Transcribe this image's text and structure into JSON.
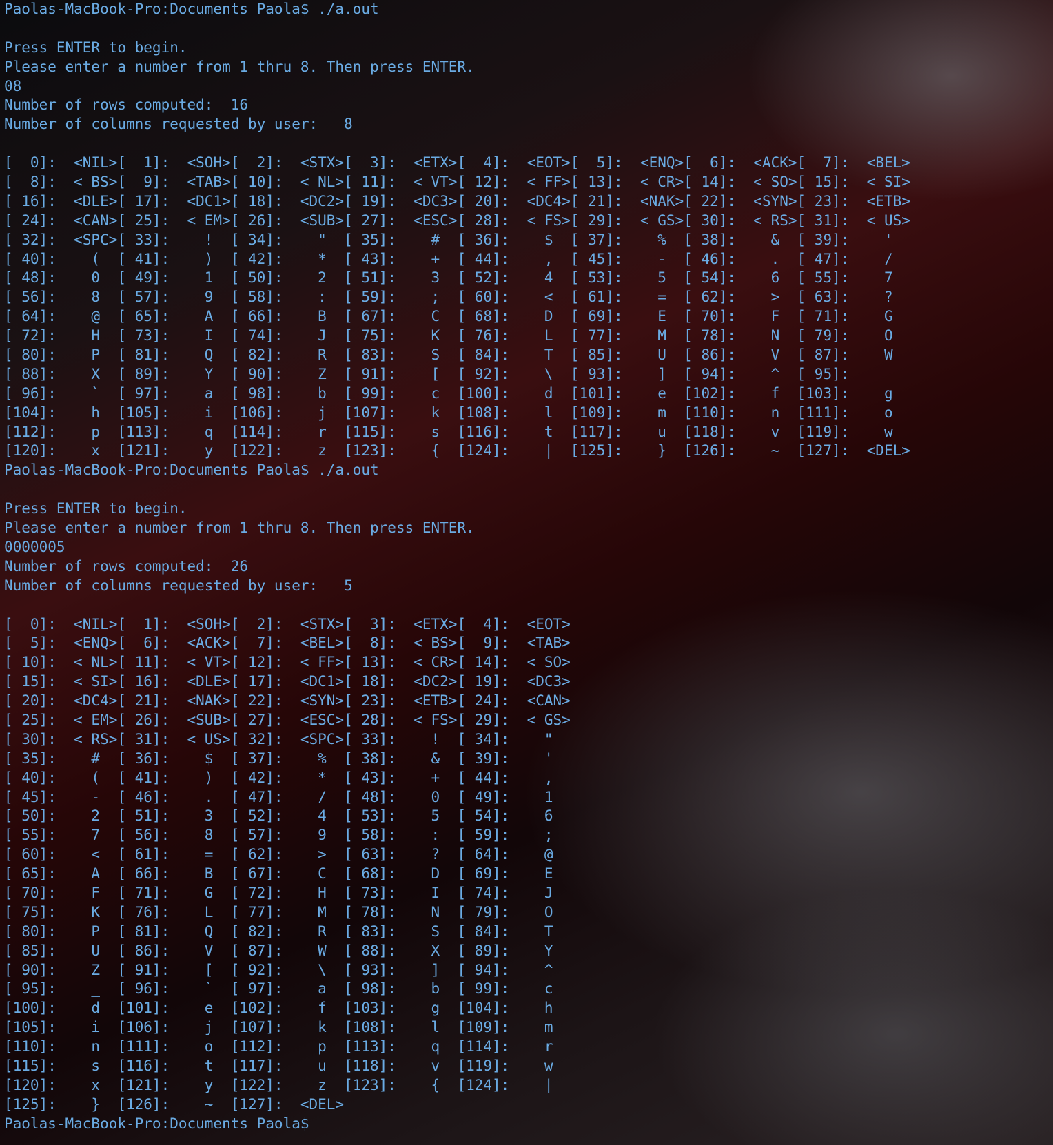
{
  "terminal": {
    "lines": [
      "Paolas-MacBook-Pro:Documents Paola$ ./a.out",
      "",
      "Press ENTER to begin.",
      "Please enter a number from 1 thru 8. Then press ENTER.",
      "08",
      "Number of rows computed:  16",
      "Number of columns requested by user:   8",
      "",
      "[  0]:  <NIL>[  1]:  <SOH>[  2]:  <STX>[  3]:  <ETX>[  4]:  <EOT>[  5]:  <ENQ>[  6]:  <ACK>[  7]:  <BEL>",
      "[  8]:  < BS>[  9]:  <TAB>[ 10]:  < NL>[ 11]:  < VT>[ 12]:  < FF>[ 13]:  < CR>[ 14]:  < SO>[ 15]:  < SI>",
      "[ 16]:  <DLE>[ 17]:  <DC1>[ 18]:  <DC2>[ 19]:  <DC3>[ 20]:  <DC4>[ 21]:  <NAK>[ 22]:  <SYN>[ 23]:  <ETB>",
      "[ 24]:  <CAN>[ 25]:  < EM>[ 26]:  <SUB>[ 27]:  <ESC>[ 28]:  < FS>[ 29]:  < GS>[ 30]:  < RS>[ 31]:  < US>",
      "[ 32]:  <SPC>[ 33]:    !  [ 34]:    \"  [ 35]:    #  [ 36]:    $  [ 37]:    %  [ 38]:    &  [ 39]:    '",
      "[ 40]:    (  [ 41]:    )  [ 42]:    *  [ 43]:    +  [ 44]:    ,  [ 45]:    -  [ 46]:    .  [ 47]:    /",
      "[ 48]:    0  [ 49]:    1  [ 50]:    2  [ 51]:    3  [ 52]:    4  [ 53]:    5  [ 54]:    6  [ 55]:    7",
      "[ 56]:    8  [ 57]:    9  [ 58]:    :  [ 59]:    ;  [ 60]:    <  [ 61]:    =  [ 62]:    >  [ 63]:    ?",
      "[ 64]:    @  [ 65]:    A  [ 66]:    B  [ 67]:    C  [ 68]:    D  [ 69]:    E  [ 70]:    F  [ 71]:    G",
      "[ 72]:    H  [ 73]:    I  [ 74]:    J  [ 75]:    K  [ 76]:    L  [ 77]:    M  [ 78]:    N  [ 79]:    O",
      "[ 80]:    P  [ 81]:    Q  [ 82]:    R  [ 83]:    S  [ 84]:    T  [ 85]:    U  [ 86]:    V  [ 87]:    W",
      "[ 88]:    X  [ 89]:    Y  [ 90]:    Z  [ 91]:    [  [ 92]:    \\  [ 93]:    ]  [ 94]:    ^  [ 95]:    _",
      "[ 96]:    `  [ 97]:    a  [ 98]:    b  [ 99]:    c  [100]:    d  [101]:    e  [102]:    f  [103]:    g",
      "[104]:    h  [105]:    i  [106]:    j  [107]:    k  [108]:    l  [109]:    m  [110]:    n  [111]:    o",
      "[112]:    p  [113]:    q  [114]:    r  [115]:    s  [116]:    t  [117]:    u  [118]:    v  [119]:    w",
      "[120]:    x  [121]:    y  [122]:    z  [123]:    {  [124]:    |  [125]:    }  [126]:    ~  [127]:  <DEL>",
      "Paolas-MacBook-Pro:Documents Paola$ ./a.out",
      "",
      "Press ENTER to begin.",
      "Please enter a number from 1 thru 8. Then press ENTER.",
      "0000005",
      "Number of rows computed:  26",
      "Number of columns requested by user:   5",
      "",
      "[  0]:  <NIL>[  1]:  <SOH>[  2]:  <STX>[  3]:  <ETX>[  4]:  <EOT>",
      "[  5]:  <ENQ>[  6]:  <ACK>[  7]:  <BEL>[  8]:  < BS>[  9]:  <TAB>",
      "[ 10]:  < NL>[ 11]:  < VT>[ 12]:  < FF>[ 13]:  < CR>[ 14]:  < SO>",
      "[ 15]:  < SI>[ 16]:  <DLE>[ 17]:  <DC1>[ 18]:  <DC2>[ 19]:  <DC3>",
      "[ 20]:  <DC4>[ 21]:  <NAK>[ 22]:  <SYN>[ 23]:  <ETB>[ 24]:  <CAN>",
      "[ 25]:  < EM>[ 26]:  <SUB>[ 27]:  <ESC>[ 28]:  < FS>[ 29]:  < GS>",
      "[ 30]:  < RS>[ 31]:  < US>[ 32]:  <SPC>[ 33]:    !  [ 34]:    \"",
      "[ 35]:    #  [ 36]:    $  [ 37]:    %  [ 38]:    &  [ 39]:    '",
      "[ 40]:    (  [ 41]:    )  [ 42]:    *  [ 43]:    +  [ 44]:    ,",
      "[ 45]:    -  [ 46]:    .  [ 47]:    /  [ 48]:    0  [ 49]:    1",
      "[ 50]:    2  [ 51]:    3  [ 52]:    4  [ 53]:    5  [ 54]:    6",
      "[ 55]:    7  [ 56]:    8  [ 57]:    9  [ 58]:    :  [ 59]:    ;",
      "[ 60]:    <  [ 61]:    =  [ 62]:    >  [ 63]:    ?  [ 64]:    @",
      "[ 65]:    A  [ 66]:    B  [ 67]:    C  [ 68]:    D  [ 69]:    E",
      "[ 70]:    F  [ 71]:    G  [ 72]:    H  [ 73]:    I  [ 74]:    J",
      "[ 75]:    K  [ 76]:    L  [ 77]:    M  [ 78]:    N  [ 79]:    O",
      "[ 80]:    P  [ 81]:    Q  [ 82]:    R  [ 83]:    S  [ 84]:    T",
      "[ 85]:    U  [ 86]:    V  [ 87]:    W  [ 88]:    X  [ 89]:    Y",
      "[ 90]:    Z  [ 91]:    [  [ 92]:    \\  [ 93]:    ]  [ 94]:    ^",
      "[ 95]:    _  [ 96]:    `  [ 97]:    a  [ 98]:    b  [ 99]:    c",
      "[100]:    d  [101]:    e  [102]:    f  [103]:    g  [104]:    h",
      "[105]:    i  [106]:    j  [107]:    k  [108]:    l  [109]:    m",
      "[110]:    n  [111]:    o  [112]:    p  [113]:    q  [114]:    r",
      "[115]:    s  [116]:    t  [117]:    u  [118]:    v  [119]:    w",
      "[120]:    x  [121]:    y  [122]:    z  [123]:    {  [124]:    |",
      "[125]:    }  [126]:    ~  [127]:  <DEL>",
      "Paolas-MacBook-Pro:Documents Paola$"
    ]
  }
}
